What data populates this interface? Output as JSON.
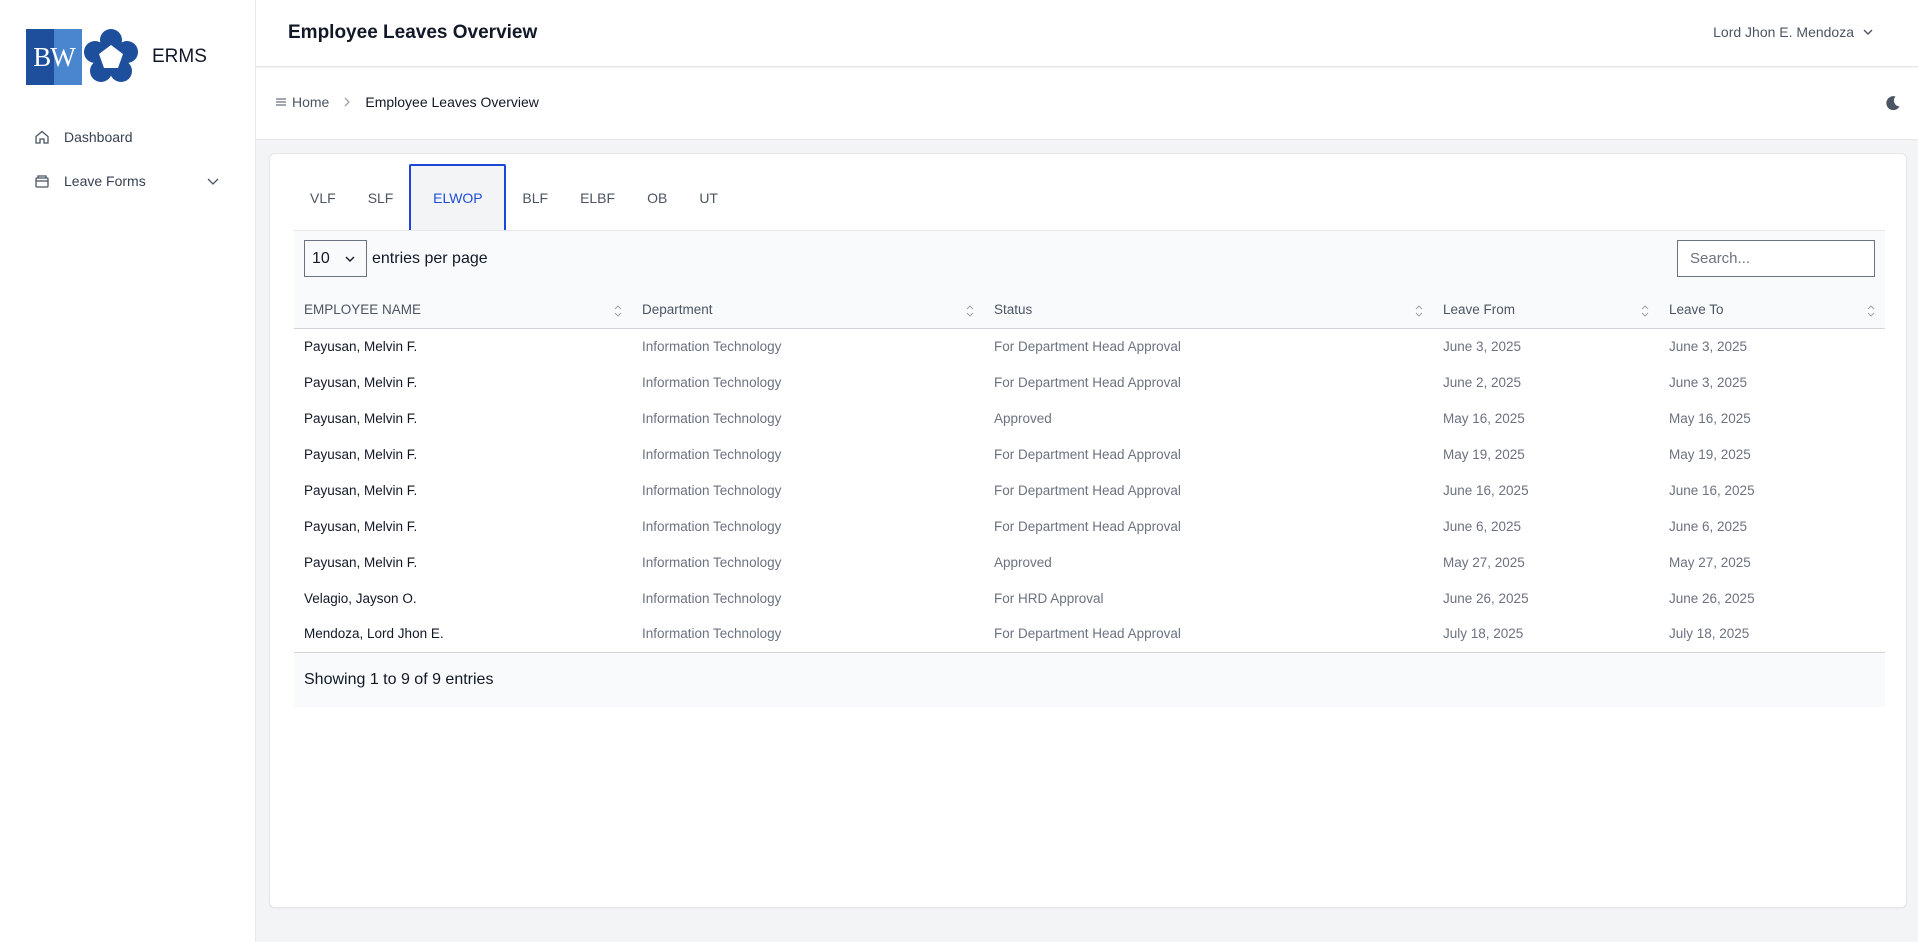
{
  "brand": {
    "logo_text": "BW",
    "name": "ERMS"
  },
  "sidebar": {
    "items": [
      {
        "label": "Dashboard",
        "icon": "home-icon"
      },
      {
        "label": "Leave Forms",
        "icon": "folder-icon",
        "expandable": true
      }
    ]
  },
  "header": {
    "title": "Employee Leaves Overview",
    "user": "Lord Jhon E. Mendoza"
  },
  "breadcrumb": {
    "home": "Home",
    "current": "Employee Leaves Overview"
  },
  "tabs": [
    "VLF",
    "SLF",
    "ELWOP",
    "BLF",
    "ELBF",
    "OB",
    "UT"
  ],
  "active_tab": "ELWOP",
  "table": {
    "per_page_value": "10",
    "per_page_label": "entries per page",
    "search_placeholder": "Search...",
    "columns": [
      "EMPLOYEE NAME",
      "Department",
      "Status",
      "Leave From",
      "Leave To"
    ],
    "rows": [
      [
        "Payusan, Melvin F.",
        "Information Technology",
        "For Department Head Approval",
        "June 3, 2025",
        "June 3, 2025"
      ],
      [
        "Payusan, Melvin F.",
        "Information Technology",
        "For Department Head Approval",
        "June 2, 2025",
        "June 3, 2025"
      ],
      [
        "Payusan, Melvin F.",
        "Information Technology",
        "Approved",
        "May 16, 2025",
        "May 16, 2025"
      ],
      [
        "Payusan, Melvin F.",
        "Information Technology",
        "For Department Head Approval",
        "May 19, 2025",
        "May 19, 2025"
      ],
      [
        "Payusan, Melvin F.",
        "Information Technology",
        "For Department Head Approval",
        "June 16, 2025",
        "June 16, 2025"
      ],
      [
        "Payusan, Melvin F.",
        "Information Technology",
        "For Department Head Approval",
        "June 6, 2025",
        "June 6, 2025"
      ],
      [
        "Payusan, Melvin F.",
        "Information Technology",
        "Approved",
        "May 27, 2025",
        "May 27, 2025"
      ],
      [
        "Velagio, Jayson O.",
        "Information Technology",
        "For HRD Approval",
        "June 26, 2025",
        "June 26, 2025"
      ],
      [
        "Mendoza, Lord Jhon E.",
        "Information Technology",
        "For Department Head Approval",
        "July 18, 2025",
        "July 18, 2025"
      ]
    ],
    "footer": "Showing 1 to 9 of 9 entries"
  },
  "colors": {
    "accent": "#1d4ed8",
    "active_tab_border": "#1c46d6",
    "logo_dark": "#1e4f9c",
    "logo_light": "#4a86cf"
  }
}
